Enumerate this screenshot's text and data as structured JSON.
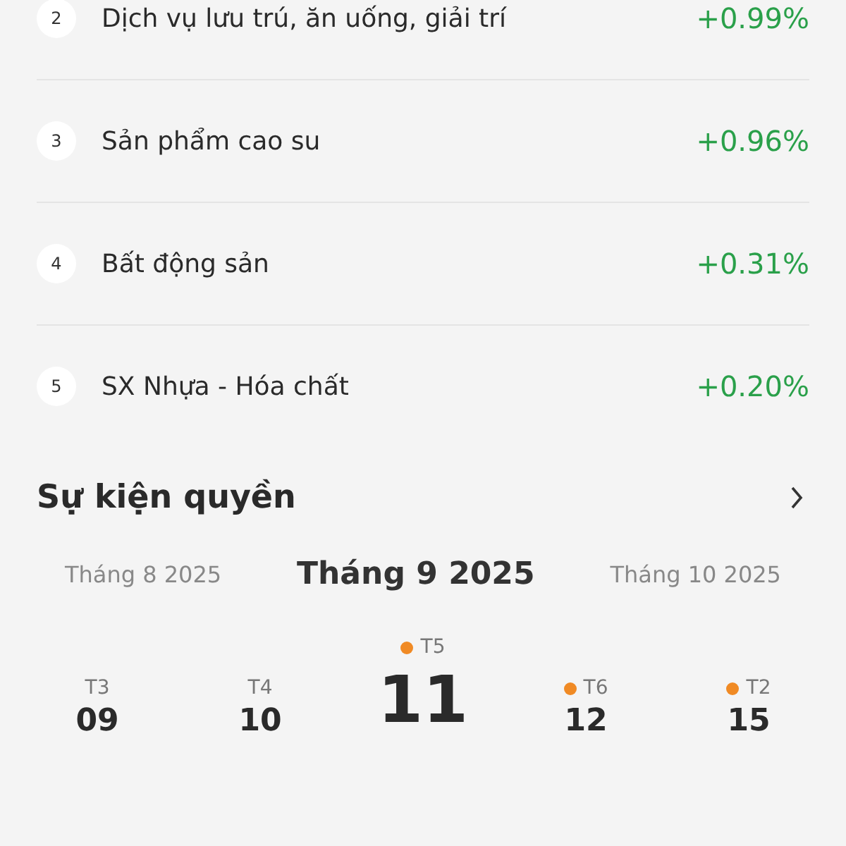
{
  "sectors": [
    {
      "rank": "2",
      "name": "Dịch vụ lưu trú, ăn uống, giải trí",
      "change": "+0.99%"
    },
    {
      "rank": "3",
      "name": "Sản phẩm cao su",
      "change": "+0.96%"
    },
    {
      "rank": "4",
      "name": "Bất động sản",
      "change": "+0.31%"
    },
    {
      "rank": "5",
      "name": "SX Nhựa - Hóa chất",
      "change": "+0.20%"
    }
  ],
  "events": {
    "title": "Sự kiện quyền",
    "months": [
      {
        "label": "Tháng 8 2025",
        "selected": false
      },
      {
        "label": "Tháng 9 2025",
        "selected": true
      },
      {
        "label": "Tháng 10 2025",
        "selected": false
      }
    ],
    "days": [
      {
        "weekday": "T3",
        "day": "09",
        "has_event": false,
        "selected": false
      },
      {
        "weekday": "T4",
        "day": "10",
        "has_event": false,
        "selected": false
      },
      {
        "weekday": "T5",
        "day": "11",
        "has_event": true,
        "selected": true
      },
      {
        "weekday": "T6",
        "day": "12",
        "has_event": true,
        "selected": false
      },
      {
        "weekday": "T2",
        "day": "15",
        "has_event": true,
        "selected": false
      }
    ]
  }
}
